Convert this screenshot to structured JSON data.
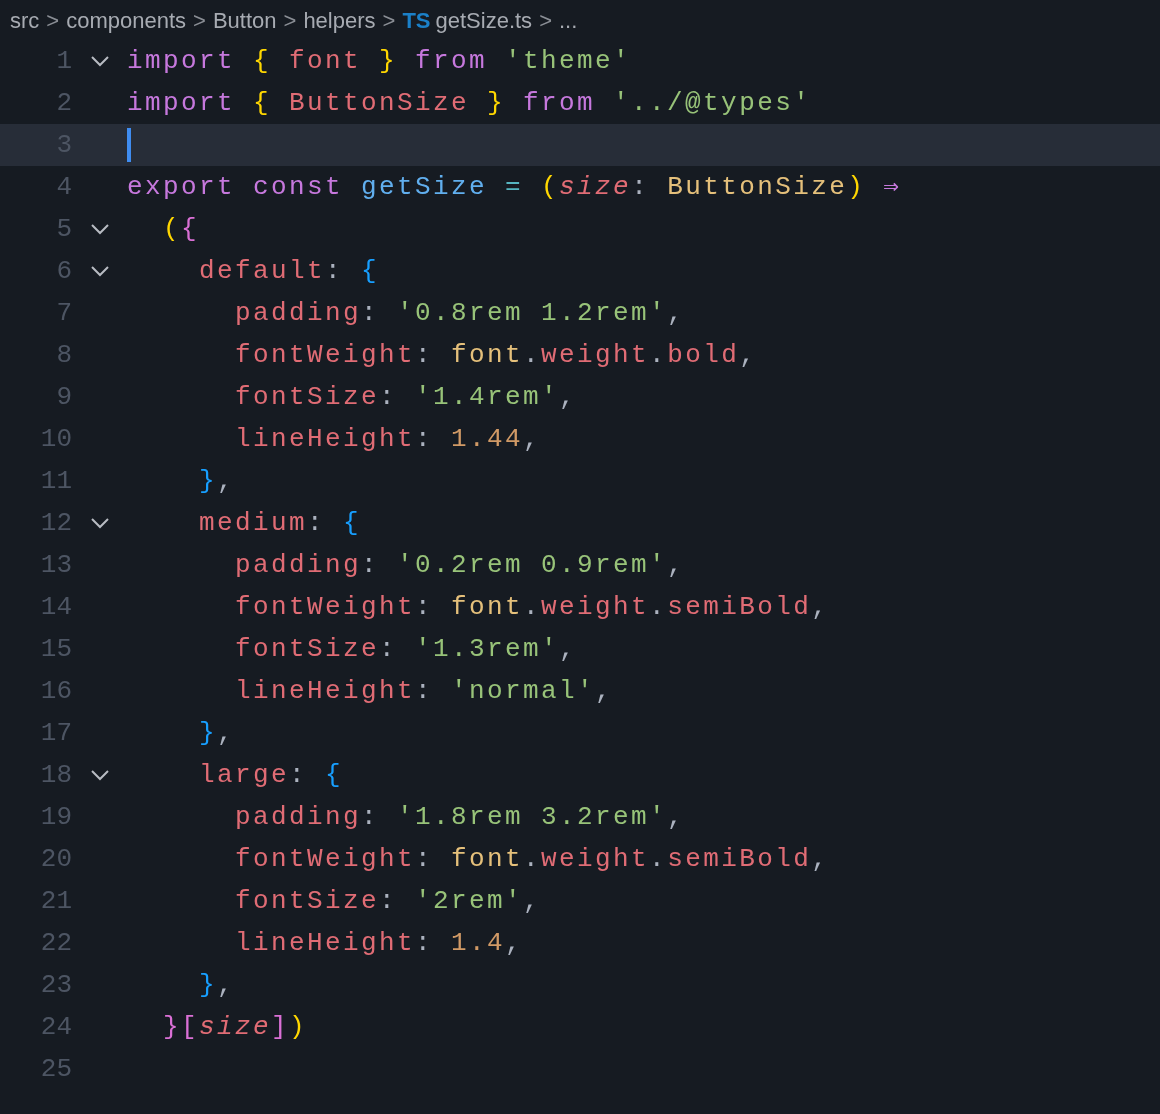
{
  "breadcrumb": [
    {
      "kind": "folder",
      "text": "src"
    },
    {
      "kind": "separator",
      "text": ">"
    },
    {
      "kind": "folder",
      "text": "components"
    },
    {
      "kind": "separator",
      "text": ">"
    },
    {
      "kind": "folder",
      "text": "Button"
    },
    {
      "kind": "separator",
      "text": ">"
    },
    {
      "kind": "folder",
      "text": "helpers"
    },
    {
      "kind": "separator",
      "text": ">"
    },
    {
      "kind": "badge",
      "text": "TS"
    },
    {
      "kind": "file",
      "text": "getSize.ts"
    },
    {
      "kind": "separator",
      "text": ">"
    },
    {
      "kind": "folder",
      "text": "..."
    }
  ],
  "lines": [
    {
      "number": "1",
      "fold": true,
      "current": false,
      "tokens": [
        {
          "kind": "kw",
          "text": "import "
        },
        {
          "kind": "b1",
          "text": "{ "
        },
        {
          "kind": "prop",
          "text": "font "
        },
        {
          "kind": "b1",
          "text": "} "
        },
        {
          "kind": "kw",
          "text": "from "
        },
        {
          "kind": "str",
          "text": "'theme'"
        }
      ]
    },
    {
      "number": "2",
      "fold": false,
      "current": false,
      "tokens": [
        {
          "kind": "kw",
          "text": "import "
        },
        {
          "kind": "b1",
          "text": "{ "
        },
        {
          "kind": "prop",
          "text": "ButtonSize "
        },
        {
          "kind": "b1",
          "text": "} "
        },
        {
          "kind": "kw",
          "text": "from "
        },
        {
          "kind": "str",
          "text": "'../@types'"
        }
      ]
    },
    {
      "number": "3",
      "fold": false,
      "current": true
    },
    {
      "number": "4",
      "fold": false,
      "current": false,
      "tokens": [
        {
          "kind": "kw",
          "text": "export "
        },
        {
          "kind": "kw",
          "text": "const "
        },
        {
          "kind": "fn",
          "text": "getSize "
        },
        {
          "kind": "op",
          "text": "= "
        },
        {
          "kind": "b1",
          "text": "("
        },
        {
          "kind": "param",
          "text": "size"
        },
        {
          "kind": "punct",
          "text": ": "
        },
        {
          "kind": "type",
          "text": "ButtonSize"
        },
        {
          "kind": "b1",
          "text": ") "
        },
        {
          "kind": "kw",
          "text": "⇒"
        }
      ]
    },
    {
      "number": "5",
      "fold": true,
      "current": false,
      "tokens": [
        {
          "kind": "b1",
          "text": "  ("
        },
        {
          "kind": "b2",
          "text": "{"
        }
      ]
    },
    {
      "number": "6",
      "fold": true,
      "current": false,
      "tokens": [
        {
          "kind": "prop",
          "text": "    default"
        },
        {
          "kind": "punct",
          "text": ": "
        },
        {
          "kind": "b3",
          "text": "{"
        }
      ]
    },
    {
      "number": "7",
      "fold": false,
      "current": false,
      "tokens": [
        {
          "kind": "prop",
          "text": "      padding"
        },
        {
          "kind": "punct",
          "text": ": "
        },
        {
          "kind": "str",
          "text": "'0.8rem 1.2rem'"
        },
        {
          "kind": "punct",
          "text": ","
        }
      ]
    },
    {
      "number": "8",
      "fold": false,
      "current": false,
      "tokens": [
        {
          "kind": "prop",
          "text": "      fontWeight"
        },
        {
          "kind": "punct",
          "text": ": "
        },
        {
          "kind": "type",
          "text": "font"
        },
        {
          "kind": "punct",
          "text": "."
        },
        {
          "kind": "prop",
          "text": "weight"
        },
        {
          "kind": "punct",
          "text": "."
        },
        {
          "kind": "prop",
          "text": "bold"
        },
        {
          "kind": "punct",
          "text": ","
        }
      ]
    },
    {
      "number": "9",
      "fold": false,
      "current": false,
      "tokens": [
        {
          "kind": "prop",
          "text": "      fontSize"
        },
        {
          "kind": "punct",
          "text": ": "
        },
        {
          "kind": "str",
          "text": "'1.4rem'"
        },
        {
          "kind": "punct",
          "text": ","
        }
      ]
    },
    {
      "number": "10",
      "fold": false,
      "current": false,
      "tokens": [
        {
          "kind": "prop",
          "text": "      lineHeight"
        },
        {
          "kind": "punct",
          "text": ": "
        },
        {
          "kind": "num",
          "text": "1.44"
        },
        {
          "kind": "punct",
          "text": ","
        }
      ]
    },
    {
      "number": "11",
      "fold": false,
      "current": false,
      "tokens": [
        {
          "kind": "b3",
          "text": "    }"
        },
        {
          "kind": "punct",
          "text": ","
        }
      ]
    },
    {
      "number": "12",
      "fold": true,
      "current": false,
      "tokens": [
        {
          "kind": "prop",
          "text": "    medium"
        },
        {
          "kind": "punct",
          "text": ": "
        },
        {
          "kind": "b3",
          "text": "{"
        }
      ]
    },
    {
      "number": "13",
      "fold": false,
      "current": false,
      "tokens": [
        {
          "kind": "prop",
          "text": "      padding"
        },
        {
          "kind": "punct",
          "text": ": "
        },
        {
          "kind": "str",
          "text": "'0.2rem 0.9rem'"
        },
        {
          "kind": "punct",
          "text": ","
        }
      ]
    },
    {
      "number": "14",
      "fold": false,
      "current": false,
      "tokens": [
        {
          "kind": "prop",
          "text": "      fontWeight"
        },
        {
          "kind": "punct",
          "text": ": "
        },
        {
          "kind": "type",
          "text": "font"
        },
        {
          "kind": "punct",
          "text": "."
        },
        {
          "kind": "prop",
          "text": "weight"
        },
        {
          "kind": "punct",
          "text": "."
        },
        {
          "kind": "prop",
          "text": "semiBold"
        },
        {
          "kind": "punct",
          "text": ","
        }
      ]
    },
    {
      "number": "15",
      "fold": false,
      "current": false,
      "tokens": [
        {
          "kind": "prop",
          "text": "      fontSize"
        },
        {
          "kind": "punct",
          "text": ": "
        },
        {
          "kind": "str",
          "text": "'1.3rem'"
        },
        {
          "kind": "punct",
          "text": ","
        }
      ]
    },
    {
      "number": "16",
      "fold": false,
      "current": false,
      "tokens": [
        {
          "kind": "prop",
          "text": "      lineHeight"
        },
        {
          "kind": "punct",
          "text": ": "
        },
        {
          "kind": "str",
          "text": "'normal'"
        },
        {
          "kind": "punct",
          "text": ","
        }
      ]
    },
    {
      "number": "17",
      "fold": false,
      "current": false,
      "tokens": [
        {
          "kind": "b3",
          "text": "    }"
        },
        {
          "kind": "punct",
          "text": ","
        }
      ]
    },
    {
      "number": "18",
      "fold": true,
      "current": false,
      "tokens": [
        {
          "kind": "prop",
          "text": "    large"
        },
        {
          "kind": "punct",
          "text": ": "
        },
        {
          "kind": "b3",
          "text": "{"
        }
      ]
    },
    {
      "number": "19",
      "fold": false,
      "current": false,
      "tokens": [
        {
          "kind": "prop",
          "text": "      padding"
        },
        {
          "kind": "punct",
          "text": ": "
        },
        {
          "kind": "str",
          "text": "'1.8rem 3.2rem'"
        },
        {
          "kind": "punct",
          "text": ","
        }
      ]
    },
    {
      "number": "20",
      "fold": false,
      "current": false,
      "tokens": [
        {
          "kind": "prop",
          "text": "      fontWeight"
        },
        {
          "kind": "punct",
          "text": ": "
        },
        {
          "kind": "type",
          "text": "font"
        },
        {
          "kind": "punct",
          "text": "."
        },
        {
          "kind": "prop",
          "text": "weight"
        },
        {
          "kind": "punct",
          "text": "."
        },
        {
          "kind": "prop",
          "text": "semiBold"
        },
        {
          "kind": "punct",
          "text": ","
        }
      ]
    },
    {
      "number": "21",
      "fold": false,
      "current": false,
      "tokens": [
        {
          "kind": "prop",
          "text": "      fontSize"
        },
        {
          "kind": "punct",
          "text": ": "
        },
        {
          "kind": "str",
          "text": "'2rem'"
        },
        {
          "kind": "punct",
          "text": ","
        }
      ]
    },
    {
      "number": "22",
      "fold": false,
      "current": false,
      "tokens": [
        {
          "kind": "prop",
          "text": "      lineHeight"
        },
        {
          "kind": "punct",
          "text": ": "
        },
        {
          "kind": "num",
          "text": "1.4"
        },
        {
          "kind": "punct",
          "text": ","
        }
      ]
    },
    {
      "number": "23",
      "fold": false,
      "current": false,
      "tokens": [
        {
          "kind": "b3",
          "text": "    }"
        },
        {
          "kind": "punct",
          "text": ","
        }
      ]
    },
    {
      "number": "24",
      "fold": false,
      "current": false,
      "tokens": [
        {
          "kind": "b2",
          "text": "  }["
        },
        {
          "kind": "param",
          "text": "size"
        },
        {
          "kind": "b2",
          "text": "]"
        },
        {
          "kind": "b1",
          "text": ")"
        }
      ]
    },
    {
      "number": "25",
      "fold": false,
      "current": false
    }
  ]
}
